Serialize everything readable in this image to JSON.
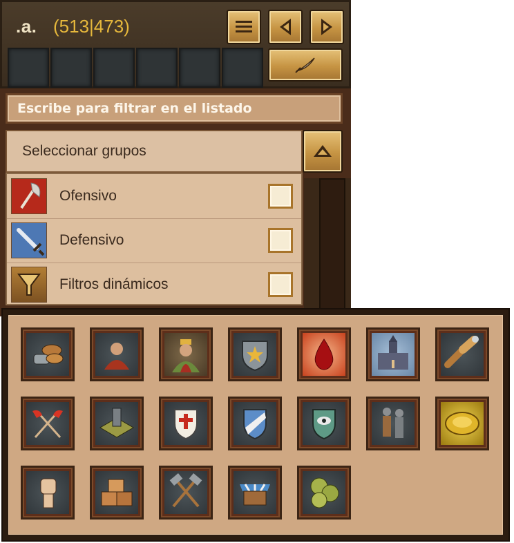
{
  "village": {
    "name": ".a.",
    "coords": "(513|473)"
  },
  "filter": {
    "placeholder_text": "Escribe para filtrar en el listado"
  },
  "groups": {
    "select_label": "Seleccionar grupos",
    "items": [
      {
        "label": "Ofensivo",
        "icon": "axe-icon",
        "checked": false
      },
      {
        "label": "Defensivo",
        "icon": "sword-icon",
        "checked": false
      },
      {
        "label": "Filtros dinámicos",
        "icon": "funnel-icon",
        "checked": false
      }
    ]
  },
  "icon_grid": {
    "rows": [
      [
        "resources-icon",
        "barbarian-chief-icon",
        "king-portrait-icon",
        "star-shield-icon",
        "blood-drop-icon",
        "cathedral-icon",
        "spyglass-icon"
      ],
      [
        "crossed-axes-icon",
        "watchtower-icon",
        "cross-shield-icon",
        "striped-shield-icon",
        "eye-shield-icon",
        "knights-icon",
        "gold-treasure-icon"
      ],
      [
        "fist-icon",
        "crates-icon",
        "crossed-hammers-icon",
        "market-stall-icon",
        "green-orbs-icon"
      ]
    ]
  },
  "colors": {
    "gold": "#e6b83c",
    "panel_brown": "#4b3c2a",
    "parchment": "#dcc0a3"
  }
}
